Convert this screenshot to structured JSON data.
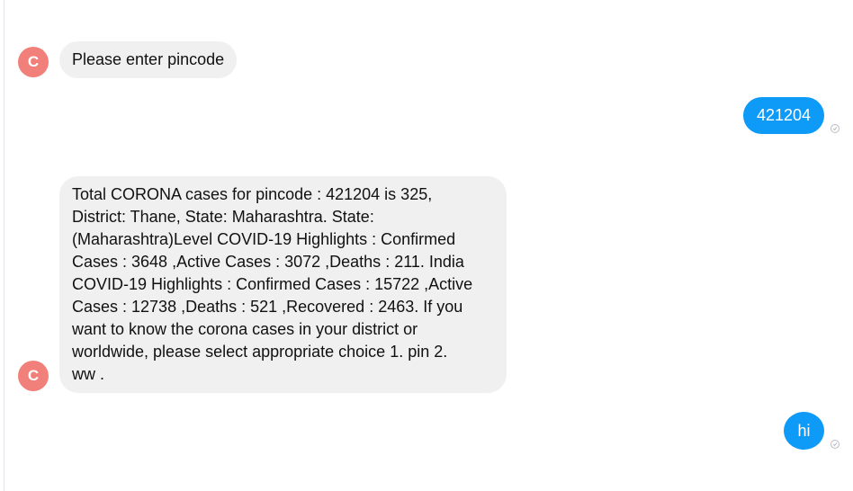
{
  "messages": [
    {
      "sender": "bot",
      "avatar_initial": "C",
      "text": "Please enter pincode"
    },
    {
      "sender": "user",
      "text": "421204",
      "status_icon": "sent-check-icon"
    },
    {
      "sender": "bot",
      "avatar_initial": "C",
      "lines": [
        "Total CORONA cases for pincode : 421204 is 325,",
        "District: Thane, State: Maharashtra.  State:",
        "(Maharashtra)Level COVID-19 Highlights :  Confirmed",
        "Cases : 3648 ,Active Cases : 3072 ,Deaths : 211.  India",
        "COVID-19 Highlights :  Confirmed Cases : 15722 ,Active",
        "Cases : 12738 ,Deaths : 521 ,Recovered : 2463.  If you",
        "want to know the corona cases in your district or",
        "worldwide, please select appropriate choice  1. pin  2.",
        "ww  ."
      ]
    },
    {
      "sender": "user",
      "text": "hi",
      "status_icon": "sent-check-icon"
    }
  ],
  "colors": {
    "avatar": "#f1807a",
    "incoming_bubble": "#f0f0f0",
    "outgoing_bubble": "#0e9af7",
    "status_icon": "#b8bcc2"
  }
}
